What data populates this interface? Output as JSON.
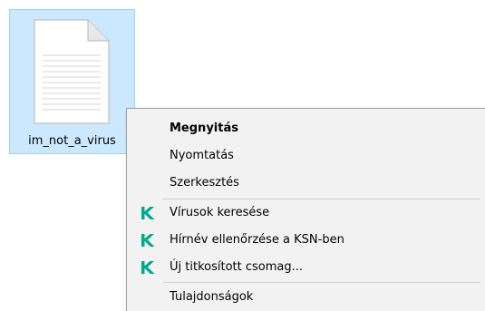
{
  "file": {
    "name": "im_not_a_virus",
    "icon": "text-document-icon"
  },
  "context_menu": {
    "items": [
      {
        "label": "Megnyitás",
        "bold": true,
        "icon": null
      },
      {
        "label": "Nyomtatás",
        "bold": false,
        "icon": null
      },
      {
        "label": "Szerkesztés",
        "bold": false,
        "icon": null
      },
      {
        "label": "Vírusok keresése",
        "bold": false,
        "icon": "kaspersky-icon"
      },
      {
        "label": "Hírnév ellenőrzése a KSN-ben",
        "bold": false,
        "icon": "kaspersky-icon"
      },
      {
        "label": "Új titkosított csomag...",
        "bold": false,
        "icon": "kaspersky-icon"
      },
      {
        "label": "Tulajdonságok",
        "bold": false,
        "icon": null
      }
    ]
  },
  "colors": {
    "selection_bg": "#cce8ff",
    "selection_border": "#99d1ff",
    "menu_bg": "#f2f2f2",
    "kaspersky_green": "#00a88e"
  }
}
